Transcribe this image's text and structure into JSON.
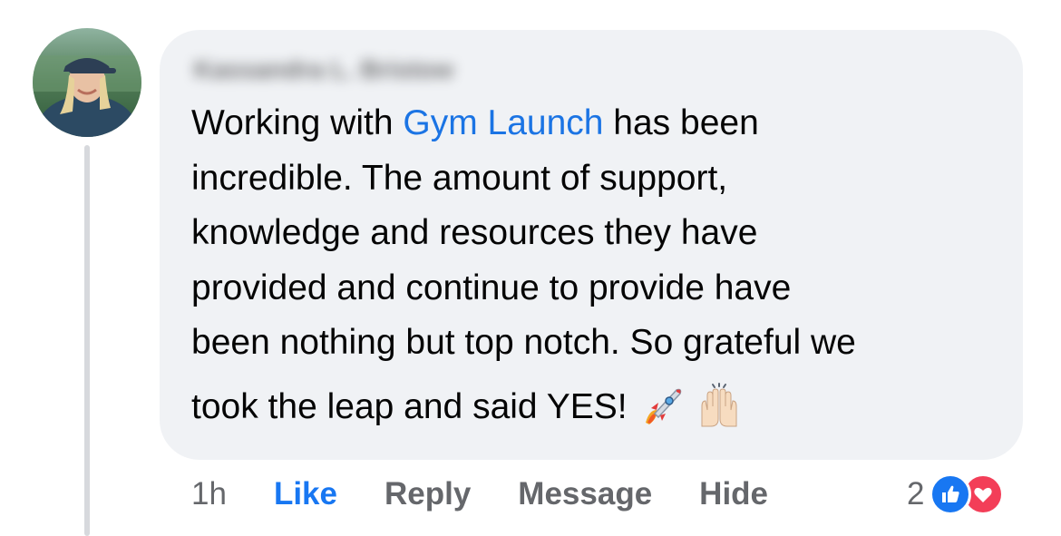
{
  "comment": {
    "author": "Kassandra L. Bristow",
    "text_lines": [
      [
        "Working with ",
        "Gym Launch",
        " has been"
      ],
      "incredible. The amount of support,",
      "knowledge and resources they have",
      "provided and continue to provide have",
      "been nothing but top notch. So grateful we",
      "took the leap and said YES!"
    ],
    "emojis": [
      "rocket-emoji",
      "raising-hands-emoji"
    ]
  },
  "actions": {
    "timestamp": "1h",
    "like": "Like",
    "reply": "Reply",
    "message": "Message",
    "hide": "Hide"
  },
  "reactions": {
    "count": "2",
    "types": [
      "like-reaction-icon",
      "love-reaction-icon"
    ]
  },
  "colors": {
    "bubble": "#f0f2f5",
    "link": "#1b74e4",
    "like_blue": "#1877f2",
    "love_red": "#f33e58",
    "muted": "#65676b"
  }
}
